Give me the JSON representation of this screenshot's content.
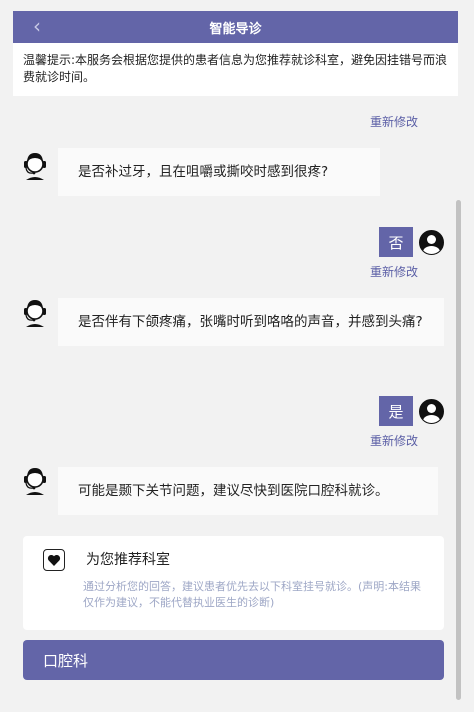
{
  "header": {
    "back_icon": "chevron-left-icon",
    "title": "智能导诊"
  },
  "notice": {
    "text": "温馨提示:本服务会根据您提供的患者信息为您推荐就诊科室，避免因挂错号而浪费就诊时间。"
  },
  "conversation": {
    "edit_label": "重新修改",
    "messages": [
      {
        "role": "bot",
        "text": "是否补过牙，且在咀嚼或撕咬时感到很疼?"
      },
      {
        "role": "user",
        "text": "否"
      },
      {
        "role": "bot",
        "text": "是否伴有下颌疼痛，张嘴时听到咯咯的声音，并感到头痛?"
      },
      {
        "role": "user",
        "text": "是"
      },
      {
        "role": "bot",
        "text": "可能是颞下关节问题，建议尽快到医院口腔科就诊。"
      }
    ]
  },
  "recommendation": {
    "icon": "heart-icon",
    "title": "为您推荐科室",
    "description": "通过分析您的回答，建议患者优先去以下科室挂号就诊。(声明:本结果仅作为建议，不能代替执业医生的诊断)",
    "department": "口腔科"
  },
  "colors": {
    "accent": "#6365a8",
    "link": "#5b5fa6",
    "hint_text": "#9ea7c6"
  }
}
